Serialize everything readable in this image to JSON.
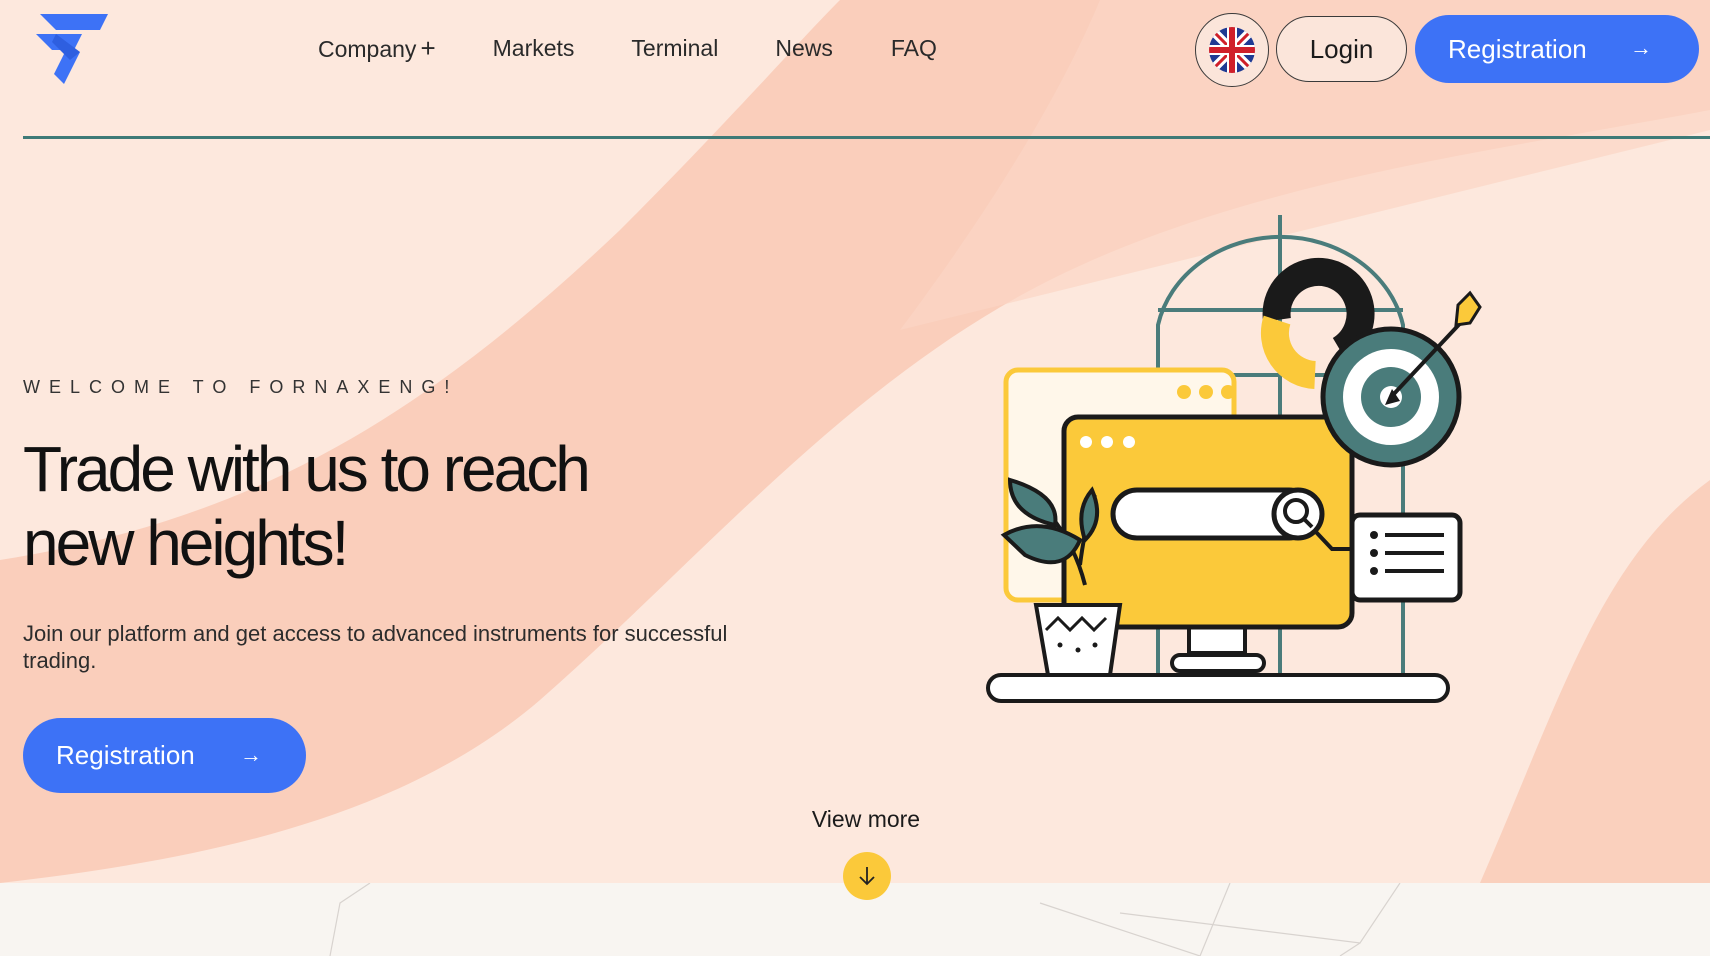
{
  "header": {
    "nav": [
      {
        "label": "Company",
        "suffix": "+"
      },
      {
        "label": "Markets"
      },
      {
        "label": "Terminal"
      },
      {
        "label": "News"
      },
      {
        "label": "FAQ"
      }
    ],
    "language_icon": "uk-flag-icon",
    "login_label": "Login",
    "registration_label": "Registration",
    "arrow_glyph": "→"
  },
  "hero": {
    "eyebrow": "WELCOME TO FORNAXENG!",
    "headline_line1": "Trade with us to reach",
    "headline_line2": "new heights!",
    "subtext": "Join our platform and get access to advanced instruments for successful trading.",
    "cta_label": "Registration",
    "view_more": "View more",
    "down_glyph": "↓"
  },
  "colors": {
    "accent": "#3d72f6",
    "hero_background": "#fde8dd",
    "wave": "#f9c7b3",
    "divider": "#3e7a77",
    "yellow": "#fbc93a",
    "teal": "#4a7c7b"
  }
}
